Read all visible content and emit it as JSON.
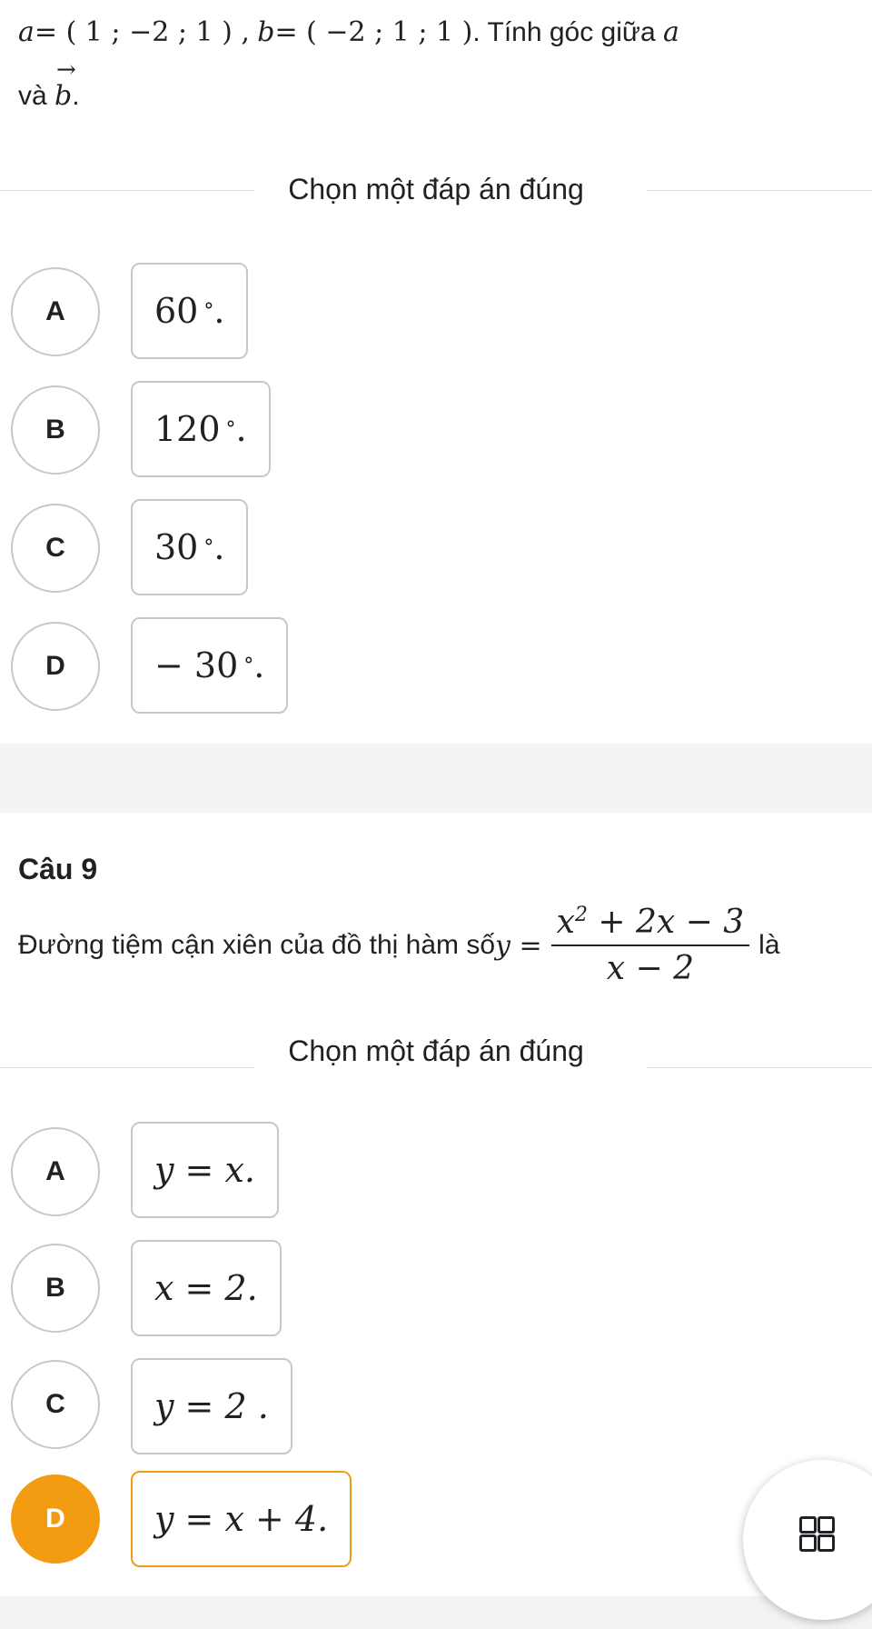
{
  "question8": {
    "text_line1_a": "a",
    "text_line1_b": "= ( 1 ; −2 ; 1 ) ,",
    "text_line1_c": "b",
    "text_line1_d": "= ( −2 ; 1 ; 1 )",
    "text_line1_e": ". Tính góc giữa ",
    "text_line1_f": "a",
    "text_line2_a": "và ",
    "text_line2_b": "b",
    "text_line2_c": ".",
    "vector_arrow": "→",
    "choose_label": "Chọn một đáp án đúng",
    "options": [
      {
        "letter": "A",
        "value": "60",
        "suffix": "."
      },
      {
        "letter": "B",
        "value": "120",
        "suffix": "."
      },
      {
        "letter": "C",
        "value": "30",
        "suffix": "."
      },
      {
        "letter": "D",
        "value": "− 30",
        "suffix": "."
      }
    ],
    "degree_symbol": "°"
  },
  "question9": {
    "header": "Câu 9",
    "text_before": "Đường tiệm cận xiên của đồ thị hàm số ",
    "func_lhs": "y =",
    "numerator_x": "x",
    "numerator_exp": "2",
    "numerator_rest": " + 2x − 3",
    "denominator": "x − 2",
    "text_after": " là",
    "choose_label": "Chọn một đáp án đúng",
    "options": [
      {
        "letter": "A",
        "value": "y = x."
      },
      {
        "letter": "B",
        "value": "x = 2."
      },
      {
        "letter": "C",
        "value": "y = 2 ."
      },
      {
        "letter": "D",
        "value": "y = x + 4."
      }
    ],
    "selected_option": "D"
  },
  "colors": {
    "selected_accent": "#f39c12",
    "border": "#c5c8ce",
    "band": "#f1f3f5"
  },
  "icons": {
    "fab": "grid-four-squares-icon"
  }
}
